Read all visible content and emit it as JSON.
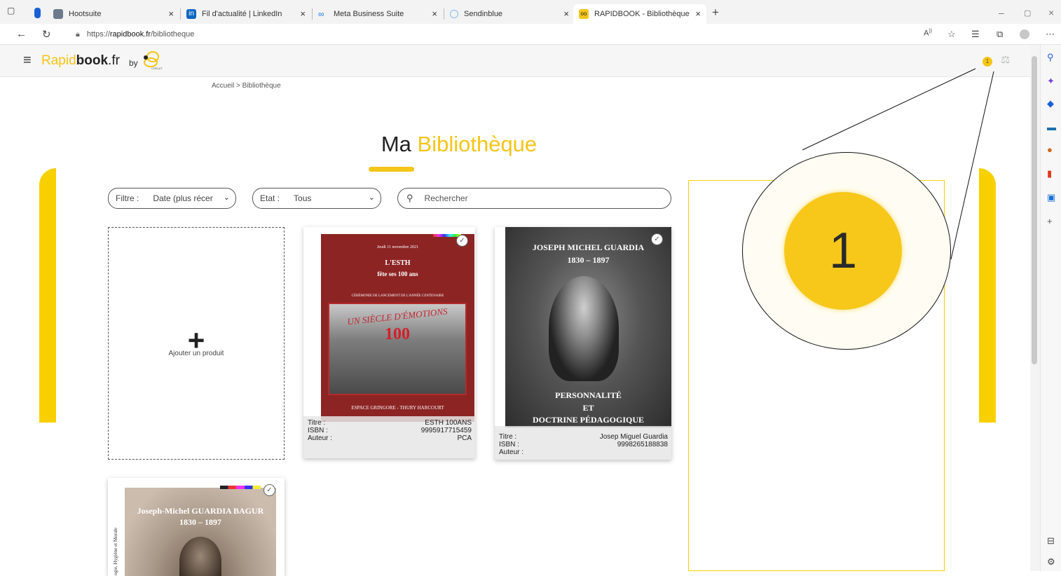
{
  "browser": {
    "tabs": [
      {
        "title": "Hootsuite",
        "color": "#6b7b8c",
        "active": false
      },
      {
        "title": "Fil d'actualité | LinkedIn",
        "color": "#0a66c2",
        "active": false
      },
      {
        "title": "Meta Business Suite",
        "color": "#1877f2",
        "active": false
      },
      {
        "title": "Sendinblue",
        "color": "#7ec1e8",
        "active": false
      },
      {
        "title": "RAPIDBOOK - Bibliothèque",
        "color": "#f5c518",
        "active": true
      }
    ],
    "new_tab": "+",
    "url_prefix": "https://",
    "url_host": "rapidbook.fr",
    "url_path": "/bibliotheque"
  },
  "header": {
    "logo_rapid": "Rapid",
    "logo_book": "book",
    "logo_fr": ".fr",
    "by": "by",
    "brand_small": "COELET",
    "cart_count": "1"
  },
  "breadcrumb": "Accueil > Bibliothèque",
  "title": {
    "part1": "Ma",
    "part2": "Bibliothèque"
  },
  "filters": {
    "filter_label": "Filtre :",
    "filter_value": "Date (plus récer",
    "state_label": "Etat :",
    "state_value": "Tous",
    "search_placeholder": "Rechercher"
  },
  "add_product": "Ajouter un produit",
  "info_labels": {
    "title": "Titre :",
    "isbn": "ISBN :",
    "author": "Auteur :"
  },
  "books": [
    {
      "cover_date": "Jeudi 11 novembre 2021",
      "cover_title1": "L'ESTH",
      "cover_title2": "fête ses 100 ans",
      "cover_sub": "CÉRÉMONIE DE LANCEMENT DE L'ANNÉE CENTENAIRE",
      "cover_banner": "UN SIÈCLE D'ÉMOTIONS",
      "cover_number": "100",
      "cover_place": "ESPACE GRINGORE - THURY HARCOURT",
      "title": "ESTH 100ANS",
      "isbn": "9995917715459",
      "author": "PCA"
    },
    {
      "cover_title1": "JOSEPH MICHEL GUARDIA",
      "cover_title2": "1830 – 1897",
      "cover_bottom1": "PERSONNALITÉ",
      "cover_bottom2": "ET",
      "cover_bottom3": "DOCTRINE PÉDAGOGIQUE",
      "title": "Josep Miguel Guardia",
      "isbn": "9998265188838",
      "author": ""
    },
    {
      "cover_title1": "Joseph-Michel GUARDIA BAGUR",
      "cover_title2": "1830 – 1897",
      "spine": "ogie, Hygiène et Morale"
    }
  ],
  "zoom_badge": "1",
  "colors": {
    "accent": "#f5c518",
    "ink": "#222222"
  }
}
